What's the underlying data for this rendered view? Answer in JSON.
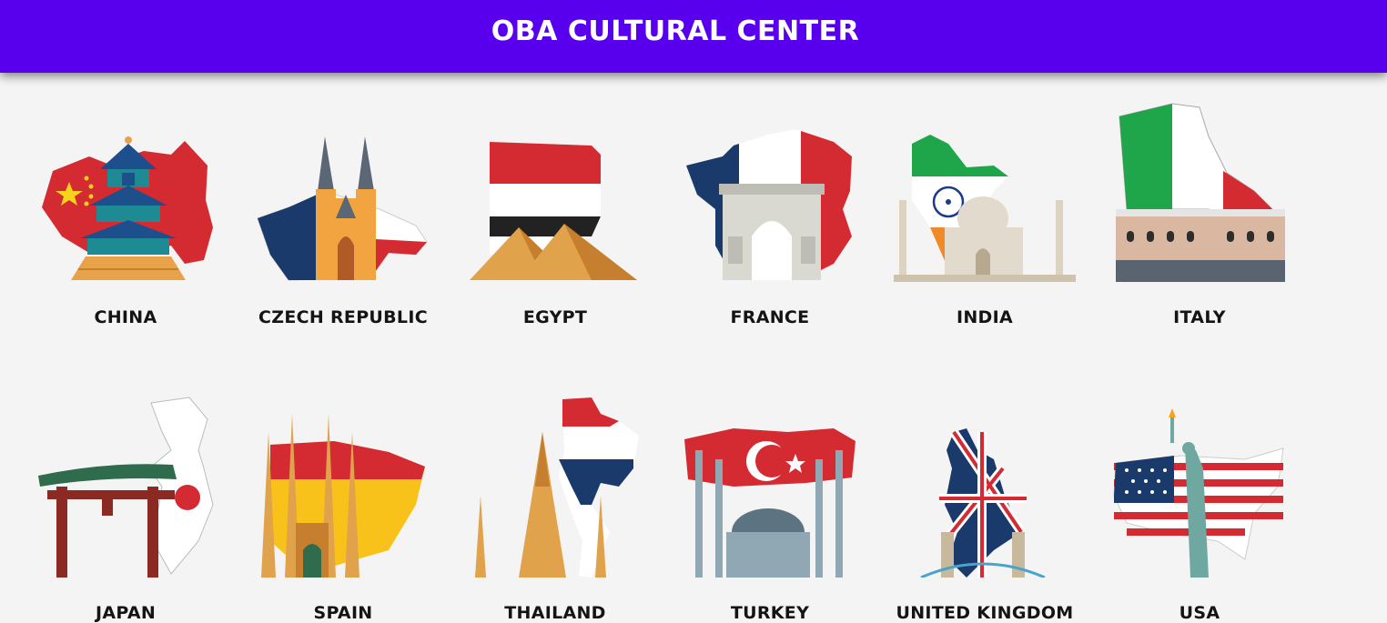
{
  "header": {
    "title": "OBA CULTURAL CENTER"
  },
  "countries": [
    {
      "name": "CHINA",
      "icon": "china-temple-of-heaven"
    },
    {
      "name": "CZECH REPUBLIC",
      "icon": "czech-tyn-church"
    },
    {
      "name": "EGYPT",
      "icon": "egypt-pyramids"
    },
    {
      "name": "FRANCE",
      "icon": "france-arc-de-triomphe"
    },
    {
      "name": "INDIA",
      "icon": "india-taj-mahal"
    },
    {
      "name": "ITALY",
      "icon": "italy-doge-palace"
    },
    {
      "name": "JAPAN",
      "icon": "japan-torii-gate"
    },
    {
      "name": "SPAIN",
      "icon": "spain-sagrada-familia"
    },
    {
      "name": "THAILAND",
      "icon": "thailand-wat-arun"
    },
    {
      "name": "TURKEY",
      "icon": "turkey-blue-mosque"
    },
    {
      "name": "UNITED KINGDOM",
      "icon": "uk-tower-bridge"
    },
    {
      "name": "USA",
      "icon": "usa-statue-of-liberty"
    }
  ],
  "colors": {
    "header_bg": "#5800ee",
    "page_bg": "#f4f4f4",
    "label_text": "#141414"
  }
}
